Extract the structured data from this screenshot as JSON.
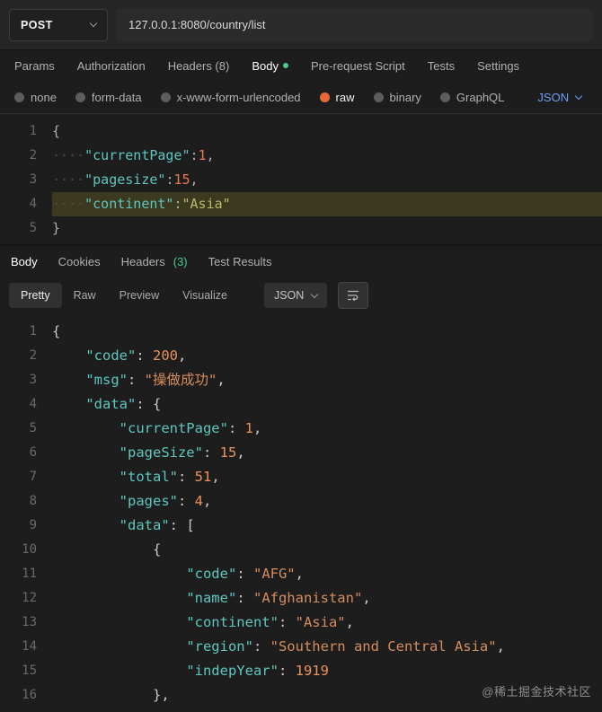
{
  "topbar": {
    "method": "POST",
    "url": "127.0.0.1:8080/country/list"
  },
  "request_tabs": [
    "Params",
    "Authorization",
    "Headers (8)",
    "Body",
    "Pre-request Script",
    "Tests",
    "Settings"
  ],
  "body_types": [
    "none",
    "form-data",
    "x-www-form-urlencoded",
    "raw",
    "binary",
    "GraphQL"
  ],
  "body_format": "JSON",
  "request_editor": {
    "lines": [
      {
        "n": "1",
        "t": [
          [
            "pun",
            "{"
          ]
        ]
      },
      {
        "n": "2",
        "t": [
          [
            "ind",
            "····"
          ],
          [
            "key",
            "\"currentPage\""
          ],
          [
            "pun",
            ":"
          ],
          [
            "num",
            "1"
          ],
          [
            "pun",
            ","
          ]
        ]
      },
      {
        "n": "3",
        "t": [
          [
            "ind",
            "····"
          ],
          [
            "key",
            "\"pagesize\""
          ],
          [
            "pun",
            ":"
          ],
          [
            "num",
            "15"
          ],
          [
            "pun",
            ","
          ]
        ]
      },
      {
        "n": "4",
        "hl": true,
        "t": [
          [
            "ind",
            "····"
          ],
          [
            "key",
            "\"continent\""
          ],
          [
            "pun",
            ":"
          ],
          [
            "str",
            "\"Asia\""
          ]
        ]
      },
      {
        "n": "5",
        "t": [
          [
            "pun",
            "}"
          ]
        ]
      }
    ]
  },
  "response_tabs": {
    "body": "Body",
    "cookies": "Cookies",
    "headers": "Headers",
    "headers_count": "(3)",
    "test_results": "Test Results"
  },
  "response_toolbar": {
    "views": [
      "Pretty",
      "Raw",
      "Preview",
      "Visualize"
    ],
    "format": "JSON"
  },
  "response_editor": {
    "lines": [
      {
        "n": "1",
        "t": [
          [
            "pun",
            "{"
          ]
        ]
      },
      {
        "n": "2",
        "t": [
          [
            "ind",
            "    "
          ],
          [
            "key",
            "\"code\""
          ],
          [
            "pun",
            ": "
          ],
          [
            "num",
            "200"
          ],
          [
            "pun",
            ","
          ]
        ]
      },
      {
        "n": "3",
        "t": [
          [
            "ind",
            "    "
          ],
          [
            "key",
            "\"msg\""
          ],
          [
            "pun",
            ": "
          ],
          [
            "str",
            "\"操做成功\""
          ],
          [
            "pun",
            ","
          ]
        ]
      },
      {
        "n": "4",
        "t": [
          [
            "ind",
            "    "
          ],
          [
            "key",
            "\"data\""
          ],
          [
            "pun",
            ": {"
          ]
        ]
      },
      {
        "n": "5",
        "t": [
          [
            "ind",
            "        "
          ],
          [
            "key",
            "\"currentPage\""
          ],
          [
            "pun",
            ": "
          ],
          [
            "num",
            "1"
          ],
          [
            "pun",
            ","
          ]
        ]
      },
      {
        "n": "6",
        "t": [
          [
            "ind",
            "        "
          ],
          [
            "key",
            "\"pageSize\""
          ],
          [
            "pun",
            ": "
          ],
          [
            "num",
            "15"
          ],
          [
            "pun",
            ","
          ]
        ]
      },
      {
        "n": "7",
        "t": [
          [
            "ind",
            "        "
          ],
          [
            "key",
            "\"total\""
          ],
          [
            "pun",
            ": "
          ],
          [
            "num",
            "51"
          ],
          [
            "pun",
            ","
          ]
        ]
      },
      {
        "n": "8",
        "t": [
          [
            "ind",
            "        "
          ],
          [
            "key",
            "\"pages\""
          ],
          [
            "pun",
            ": "
          ],
          [
            "num",
            "4"
          ],
          [
            "pun",
            ","
          ]
        ]
      },
      {
        "n": "9",
        "t": [
          [
            "ind",
            "        "
          ],
          [
            "key",
            "\"data\""
          ],
          [
            "pun",
            ": ["
          ]
        ]
      },
      {
        "n": "10",
        "t": [
          [
            "ind",
            "            "
          ],
          [
            "pun",
            "{"
          ]
        ]
      },
      {
        "n": "11",
        "t": [
          [
            "ind",
            "                "
          ],
          [
            "key",
            "\"code\""
          ],
          [
            "pun",
            ": "
          ],
          [
            "str",
            "\"AFG\""
          ],
          [
            "pun",
            ","
          ]
        ]
      },
      {
        "n": "12",
        "t": [
          [
            "ind",
            "                "
          ],
          [
            "key",
            "\"name\""
          ],
          [
            "pun",
            ": "
          ],
          [
            "str",
            "\"Afghanistan\""
          ],
          [
            "pun",
            ","
          ]
        ]
      },
      {
        "n": "13",
        "t": [
          [
            "ind",
            "                "
          ],
          [
            "key",
            "\"continent\""
          ],
          [
            "pun",
            ": "
          ],
          [
            "str",
            "\"Asia\""
          ],
          [
            "pun",
            ","
          ]
        ]
      },
      {
        "n": "14",
        "t": [
          [
            "ind",
            "                "
          ],
          [
            "key",
            "\"region\""
          ],
          [
            "pun",
            ": "
          ],
          [
            "str",
            "\"Southern and Central Asia\""
          ],
          [
            "pun",
            ","
          ]
        ]
      },
      {
        "n": "15",
        "t": [
          [
            "ind",
            "                "
          ],
          [
            "key",
            "\"indepYear\""
          ],
          [
            "pun",
            ": "
          ],
          [
            "num",
            "1919"
          ]
        ]
      },
      {
        "n": "16",
        "t": [
          [
            "ind",
            "            "
          ],
          [
            "pun",
            "},"
          ]
        ]
      }
    ]
  },
  "watermark": "@稀土掘金技术社区",
  "colors": {
    "accent_orange": "#e8683a",
    "green": "#49cc90",
    "blue": "#6a9ef5",
    "line_highlight": "#3b391f"
  }
}
